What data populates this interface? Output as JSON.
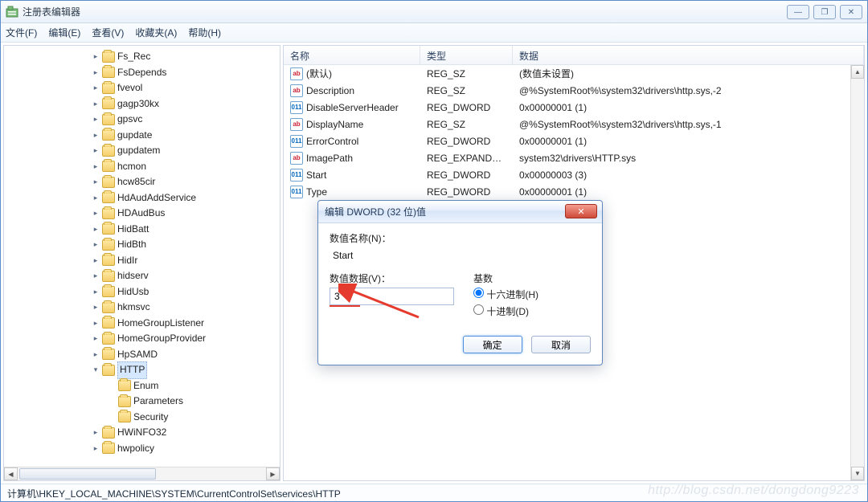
{
  "window": {
    "title": "注册表编辑器"
  },
  "winbtns": {
    "min": "—",
    "max": "❐",
    "close": "✕"
  },
  "menu": {
    "file": "文件(F)",
    "edit": "编辑(E)",
    "view": "查看(V)",
    "favorites": "收藏夹(A)",
    "help": "帮助(H)"
  },
  "tree": {
    "items": [
      "Fs_Rec",
      "FsDepends",
      "fvevol",
      "gagp30kx",
      "gpsvc",
      "gupdate",
      "gupdatem",
      "hcmon",
      "hcw85cir",
      "HdAudAddService",
      "HDAudBus",
      "HidBatt",
      "HidBth",
      "HidIr",
      "hidserv",
      "HidUsb",
      "hkmsvc",
      "HomeGroupListener",
      "HomeGroupProvider",
      "HpSAMD",
      "HTTP"
    ],
    "http_children": [
      "Enum",
      "Parameters",
      "Security"
    ],
    "tail": [
      "HWiNFO32",
      "hwpolicy"
    ]
  },
  "list": {
    "headers": {
      "name": "名称",
      "type": "类型",
      "data": "数据"
    },
    "rows": [
      {
        "icon": "str",
        "name": "(默认)",
        "type": "REG_SZ",
        "data": "(数值未设置)"
      },
      {
        "icon": "str",
        "name": "Description",
        "type": "REG_SZ",
        "data": "@%SystemRoot%\\system32\\drivers\\http.sys,-2"
      },
      {
        "icon": "bin",
        "name": "DisableServerHeader",
        "type": "REG_DWORD",
        "data": "0x00000001 (1)"
      },
      {
        "icon": "str",
        "name": "DisplayName",
        "type": "REG_SZ",
        "data": "@%SystemRoot%\\system32\\drivers\\http.sys,-1"
      },
      {
        "icon": "bin",
        "name": "ErrorControl",
        "type": "REG_DWORD",
        "data": "0x00000001 (1)"
      },
      {
        "icon": "str",
        "name": "ImagePath",
        "type": "REG_EXPAND_SZ",
        "data": "system32\\drivers\\HTTP.sys"
      },
      {
        "icon": "bin",
        "name": "Start",
        "type": "REG_DWORD",
        "data": "0x00000003 (3)"
      },
      {
        "icon": "bin",
        "name": "Type",
        "type": "REG_DWORD",
        "data": "0x00000001 (1)"
      }
    ]
  },
  "dialog": {
    "title": "编辑 DWORD (32 位)值",
    "name_label": "数值名称(N)：",
    "name_value": "Start",
    "data_label": "数值数据(V)：",
    "data_value": "3",
    "base_label": "基数",
    "hex": "十六进制(H)",
    "dec": "十进制(D)",
    "ok": "确定",
    "cancel": "取消"
  },
  "status": "计算机\\HKEY_LOCAL_MACHINE\\SYSTEM\\CurrentControlSet\\services\\HTTP",
  "watermark": "http://blog.csdn.net/dongdong9223"
}
